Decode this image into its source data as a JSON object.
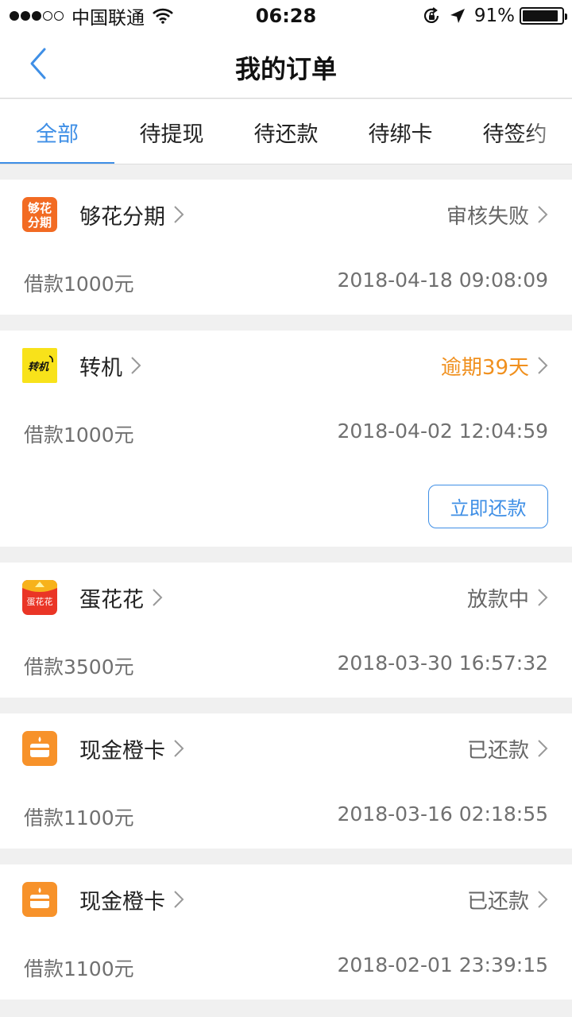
{
  "status_bar": {
    "carrier": "中国联通",
    "time": "06:28",
    "battery": "91%"
  },
  "nav": {
    "title": "我的订单"
  },
  "tabs": [
    {
      "label": "全部",
      "active": true
    },
    {
      "label": "待提现",
      "active": false
    },
    {
      "label": "待还款",
      "active": false
    },
    {
      "label": "待绑卡",
      "active": false
    },
    {
      "label": "待签约",
      "active": false
    }
  ],
  "orders": [
    {
      "name": "够花分期",
      "logo_text": [
        "够花",
        "分期"
      ],
      "status": "审核失败",
      "amount": "借款1000元",
      "time": "2018-04-18 09:08:09"
    },
    {
      "name": "转机",
      "logo_text": "转机",
      "status": "逾期39天",
      "amount": "借款1000元",
      "time": "2018-04-02 12:04:59",
      "action": "立即还款"
    },
    {
      "name": "蛋花花",
      "logo_text": "蛋花花",
      "status": "放款中",
      "amount": "借款3500元",
      "time": "2018-03-30 16:57:32"
    },
    {
      "name": "现金橙卡",
      "status": "已还款",
      "amount": "借款1100元",
      "time": "2018-03-16 02:18:55"
    },
    {
      "name": "现金橙卡",
      "status": "已还款",
      "amount": "借款1100元",
      "time": "2018-02-01 23:39:15"
    }
  ],
  "colors": {
    "accent": "#3f8fe6",
    "overdue": "#f0901e",
    "background": "#f0f0f0"
  }
}
